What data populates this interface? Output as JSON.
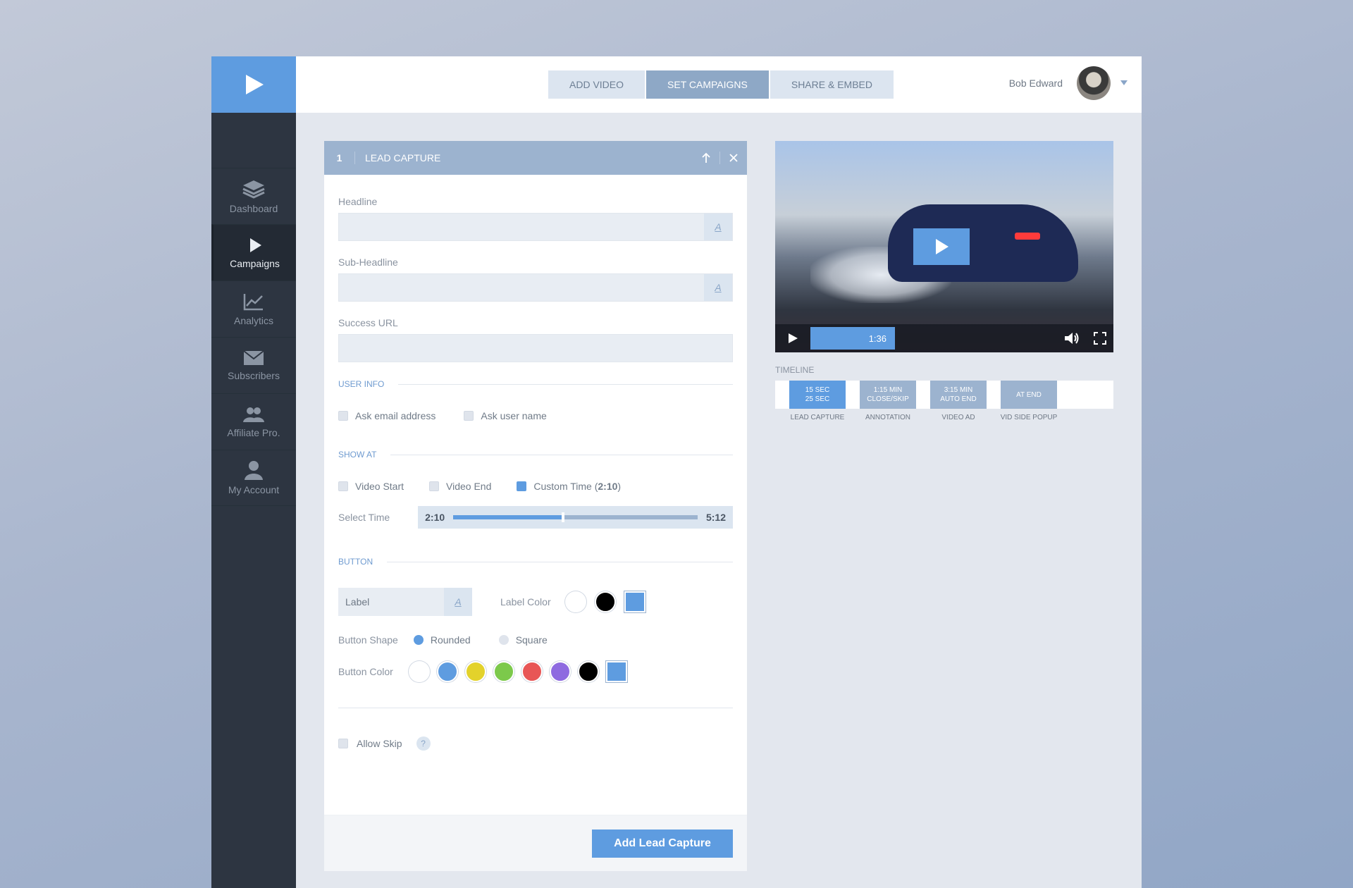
{
  "topbar": {
    "steps": [
      {
        "label": "ADD VIDEO",
        "active": false
      },
      {
        "label": "SET CAMPAIGNS",
        "active": true
      },
      {
        "label": "SHARE & EMBED",
        "active": false
      }
    ],
    "user_name": "Bob Edward"
  },
  "sidebar": {
    "items": [
      {
        "label": "Dashboard",
        "icon": "layers-icon",
        "active": false
      },
      {
        "label": "Campaigns",
        "icon": "play-icon",
        "active": true
      },
      {
        "label": "Analytics",
        "icon": "chart-line-icon",
        "active": false
      },
      {
        "label": "Subscribers",
        "icon": "envelope-icon",
        "active": false
      },
      {
        "label": "Affiliate Pro.",
        "icon": "users-icon",
        "active": false
      },
      {
        "label": "My Account",
        "icon": "user-icon",
        "active": false
      }
    ]
  },
  "panel": {
    "number": "1",
    "title": "LEAD CAPTURE",
    "headline_label": "Headline",
    "headline_value": "",
    "subheadline_label": "Sub-Headline",
    "subheadline_value": "",
    "success_url_label": "Success URL",
    "success_url_value": "",
    "text_icon": "A",
    "user_info_title": "USER INFO",
    "user_info_options": [
      {
        "label": "Ask email address",
        "checked": false
      },
      {
        "label": "Ask user name",
        "checked": false
      }
    ],
    "show_at_title": "SHOW AT",
    "show_at_options": [
      {
        "label": "Video Start",
        "checked": false
      },
      {
        "label": "Video End",
        "checked": false
      },
      {
        "label": "Custom Time (",
        "bold": "2:10",
        "suffix": ")",
        "checked": true
      }
    ],
    "select_time_label": "Select Time",
    "select_time_start": "2:10",
    "select_time_end": "5:12",
    "select_time_fraction": 0.45,
    "button_title": "BUTTON",
    "button_label_placeholder": "Label",
    "label_color_label": "Label Color",
    "label_colors": [
      "#ffffff",
      "#000000",
      "#5e9ce0"
    ],
    "button_shape_label": "Button Shape",
    "shape_options": [
      {
        "label": "Rounded",
        "selected": true
      },
      {
        "label": "Square",
        "selected": false
      }
    ],
    "button_color_label": "Button Color",
    "button_colors": [
      "#ffffff",
      "#5e9ce0",
      "#e3d22b",
      "#7cc94b",
      "#e85656",
      "#8e6ae0",
      "#000000",
      "#5e9ce0"
    ],
    "allow_skip_label": "Allow Skip",
    "allow_skip_checked": false,
    "help_label": "?",
    "submit_label": "Add Lead Capture"
  },
  "video": {
    "current_time": "1:36",
    "progress_fraction": 0.25
  },
  "timeline": {
    "title": "TIMELINE",
    "blocks": [
      {
        "line1": "15 SEC",
        "line2": "25 SEC",
        "label": "LEAD CAPTURE",
        "active": true
      },
      {
        "line1": "1:15 MIN",
        "line2": "CLOSE/SKIP",
        "label": "ANNOTATION",
        "active": false
      },
      {
        "line1": "3:15 MIN",
        "line2": "AUTO END",
        "label": "VIDEO AD",
        "active": false
      },
      {
        "line1": "AT END",
        "line2": "",
        "label": "VID SIDE POPUP",
        "active": false
      }
    ]
  },
  "colors": {
    "accent": "#5e9ce0",
    "sidebar": "#2d3541",
    "panel_header": "#9cb3cf"
  }
}
